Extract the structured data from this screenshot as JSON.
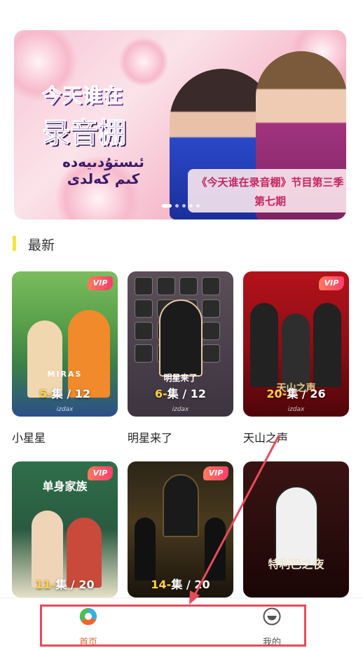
{
  "banner": {
    "logo_line1": "今天谁在",
    "logo_line2": "录音棚",
    "logo_line3": "ئىستۇدىيەدە",
    "logo_line4": "كىم كەلدى",
    "caption_line1": "《今天谁在录音棚》节目第三季",
    "caption_line2": "第七期",
    "carousel_total": 5,
    "carousel_active": 1
  },
  "section": {
    "title": "最新"
  },
  "cards": [
    {
      "title": "小星星",
      "vip": "VIP",
      "ep_current": "5",
      "ep_sep": "集",
      "ep_total": "/ 12",
      "brand": "izdax",
      "poster_text": "MIRAS"
    },
    {
      "title": "明星来了",
      "vip": "",
      "ep_current": "6",
      "ep_sep": "集",
      "ep_total": "/ 12",
      "brand": "izdax",
      "poster_text": "明星来了"
    },
    {
      "title": "天山之声",
      "vip": "VIP",
      "ep_current": "20",
      "ep_sep": "集",
      "ep_total": "/ 26",
      "brand": "izdax",
      "poster_text": "天山之声"
    },
    {
      "title": "",
      "vip": "VIP",
      "ep_current": "11",
      "ep_sep": "集",
      "ep_total": "/ 20",
      "brand": "",
      "poster_text": "单身家族"
    },
    {
      "title": "",
      "vip": "VIP",
      "ep_current": "14",
      "ep_sep": "集",
      "ep_total": "/ 20",
      "brand": "",
      "poster_text": ""
    },
    {
      "title": "",
      "vip": "",
      "ep_current": "",
      "ep_sep": "",
      "ep_total": "",
      "brand": "",
      "poster_text": "特利巴之夜"
    }
  ],
  "nav": {
    "home_label": "首页",
    "mine_label": "我的"
  },
  "colors": {
    "accent": "#e0652b",
    "section_bar": "#f5e33b",
    "highlight": "#e84a5a"
  }
}
